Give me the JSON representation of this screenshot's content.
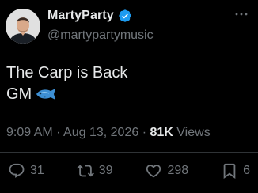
{
  "author": {
    "display_name": "MartyParty",
    "handle": "@martypartymusic",
    "verified": true
  },
  "tweet": {
    "lines": [
      "The Carp is Back",
      "GM"
    ],
    "emoji": "fish-emoji"
  },
  "meta": {
    "time": "9:09 AM",
    "separator_1": "·",
    "date": "Aug 13, 2026",
    "separator_2": "·",
    "views_count": "81K",
    "views_label": "Views"
  },
  "actions": {
    "replies": "31",
    "reposts": "39",
    "likes": "298",
    "bookmarks": "6"
  },
  "icons": [
    "verified-badge-icon",
    "more-options-icon",
    "reply-icon",
    "repost-icon",
    "like-icon",
    "bookmark-icon"
  ],
  "colors": {
    "background": "#000000",
    "primary_text": "#e7e9ea",
    "secondary_text": "#71767b",
    "verified_blue": "#1d9bf0",
    "divider": "#2f3336"
  }
}
